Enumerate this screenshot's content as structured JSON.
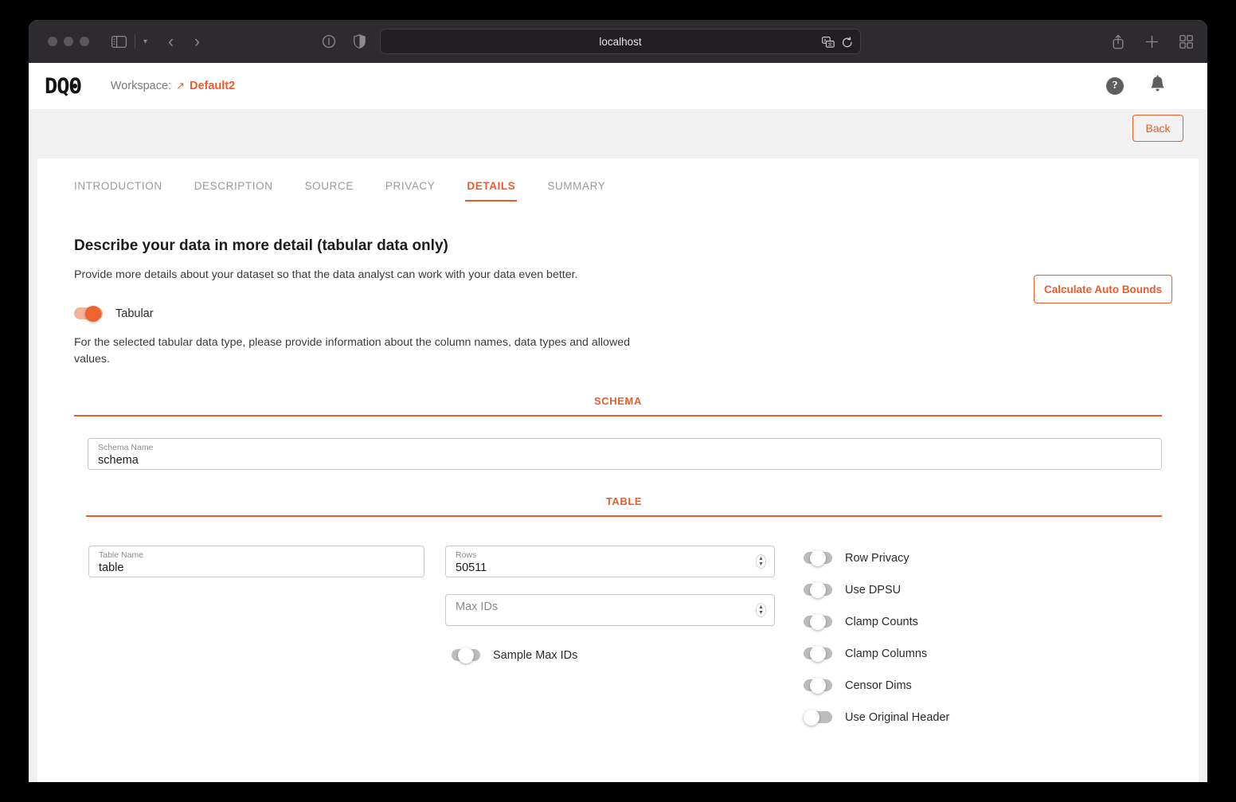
{
  "browser": {
    "url": "localhost",
    "icons": {
      "sidebar": "sidebar-icon",
      "chevron": "chevron-down-icon",
      "back": "back-arrow-icon",
      "forward": "forward-arrow-icon",
      "reader": "reader-view-icon",
      "privacy": "privacy-report-icon",
      "translate": "translate-icon",
      "reload": "reload-icon",
      "share": "share-icon",
      "newtab": "new-tab-icon",
      "tabs": "tab-overview-icon"
    }
  },
  "header": {
    "logo": "DQO",
    "workspace_label": "Workspace:",
    "workspace_arrow": "↗",
    "workspace_value": "Default2",
    "help_glyph": "?",
    "help_icon": "help-icon",
    "bell_icon": "notifications-bell-icon"
  },
  "toolbar": {
    "back_label": "Back"
  },
  "tabs": [
    {
      "label": "INTRODUCTION",
      "active": false
    },
    {
      "label": "DESCRIPTION",
      "active": false
    },
    {
      "label": "SOURCE",
      "active": false
    },
    {
      "label": "PRIVACY",
      "active": false
    },
    {
      "label": "DETAILS",
      "active": true
    },
    {
      "label": "SUMMARY",
      "active": false
    }
  ],
  "main": {
    "heading": "Describe your data in more detail (tabular data only)",
    "subheading": "Provide more details about your dataset so that the data analyst can work with your data even better.",
    "tabular_toggle_label": "Tabular",
    "tabular_toggle_state": "on",
    "auto_bounds_label": "Calculate Auto Bounds",
    "helper_text": "For the selected tabular data type, please provide information about the column names, data types and allowed values.",
    "schema_divider": "SCHEMA",
    "table_divider": "TABLE",
    "schema_name": {
      "label": "Schema Name",
      "value": "schema"
    },
    "table_name": {
      "label": "Table Name",
      "value": "table"
    },
    "rows": {
      "label": "Rows",
      "value": "50511"
    },
    "max_ids": {
      "label": "Max IDs",
      "placeholder": "Max IDs",
      "value": ""
    },
    "sample_max_ids": {
      "label": "Sample Max IDs",
      "state": "mid"
    },
    "right_toggles": [
      {
        "label": "Row Privacy",
        "state": "mid"
      },
      {
        "label": "Use DPSU",
        "state": "mid"
      },
      {
        "label": "Clamp Counts",
        "state": "mid"
      },
      {
        "label": "Clamp Columns",
        "state": "mid"
      },
      {
        "label": "Censor Dims",
        "state": "mid"
      },
      {
        "label": "Use Original Header",
        "state": "off"
      }
    ]
  },
  "colors": {
    "accent": "#ec5c2b",
    "accent_light": "#f8b49a",
    "toolbar_bg": "#2e2b30",
    "page_bg": "#f2f2f2",
    "card_bg": "#ffffff",
    "toggle_gray": "#a7a7a7"
  }
}
